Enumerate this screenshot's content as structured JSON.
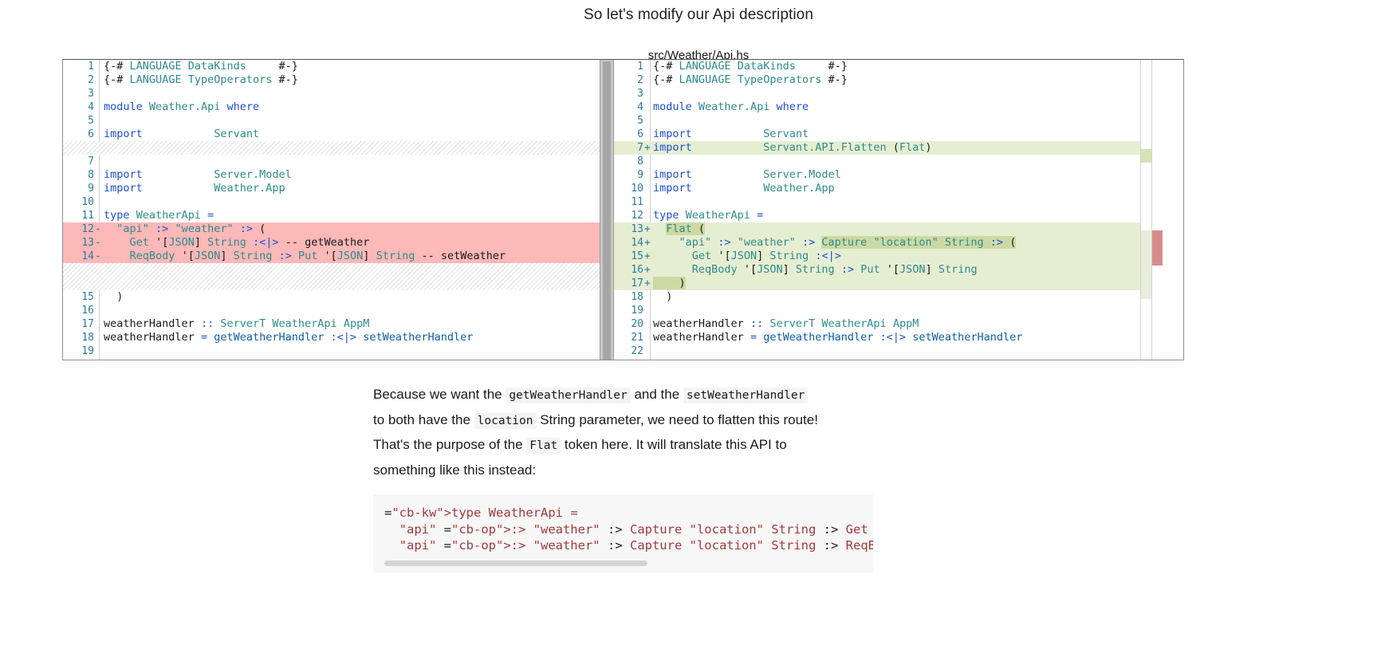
{
  "slide": {
    "title": "So let's modify our Api description",
    "file_caption": "src/Weather/Api.hs"
  },
  "diff": {
    "left": {
      "lines": [
        {
          "num": "1",
          "sign": "",
          "text": "{-# LANGUAGE DataKinds     #-}",
          "state": "context"
        },
        {
          "num": "2",
          "sign": "",
          "text": "{-# LANGUAGE TypeOperators #-}",
          "state": "context"
        },
        {
          "num": "3",
          "sign": "",
          "text": "",
          "state": "context"
        },
        {
          "num": "4",
          "sign": "",
          "text": "module Weather.Api where",
          "state": "context"
        },
        {
          "num": "5",
          "sign": "",
          "text": "",
          "state": "context"
        },
        {
          "num": "6",
          "sign": "",
          "text": "import           Servant",
          "state": "context"
        },
        {
          "num": "",
          "sign": "",
          "text": "",
          "state": "filler"
        },
        {
          "num": "7",
          "sign": "",
          "text": "",
          "state": "context"
        },
        {
          "num": "8",
          "sign": "",
          "text": "import           Server.Model",
          "state": "context"
        },
        {
          "num": "9",
          "sign": "",
          "text": "import           Weather.App",
          "state": "context"
        },
        {
          "num": "10",
          "sign": "",
          "text": "",
          "state": "context"
        },
        {
          "num": "11",
          "sign": "",
          "text": "type WeatherApi =",
          "state": "context"
        },
        {
          "num": "12",
          "sign": "-",
          "text": "  \"api\" :> \"weather\" :> (",
          "state": "deleted"
        },
        {
          "num": "13",
          "sign": "-",
          "text": "    Get '[JSON] String :<|> -- getWeather",
          "state": "deleted"
        },
        {
          "num": "14",
          "sign": "-",
          "text": "    ReqBody '[JSON] String :> Put '[JSON] String -- setWeather",
          "state": "deleted"
        },
        {
          "num": "",
          "sign": "",
          "text": "",
          "state": "filler"
        },
        {
          "num": "",
          "sign": "",
          "text": "",
          "state": "filler"
        },
        {
          "num": "15",
          "sign": "",
          "text": "  )",
          "state": "context"
        },
        {
          "num": "16",
          "sign": "",
          "text": "",
          "state": "context"
        },
        {
          "num": "17",
          "sign": "",
          "text": "weatherHandler :: ServerT WeatherApi AppM",
          "state": "context"
        },
        {
          "num": "18",
          "sign": "",
          "text": "weatherHandler = getWeatherHandler :<|> setWeatherHandler",
          "state": "context"
        },
        {
          "num": "19",
          "sign": "",
          "text": "",
          "state": "context"
        }
      ]
    },
    "right": {
      "lines": [
        {
          "num": "1",
          "sign": "",
          "text": "{-# LANGUAGE DataKinds     #-}",
          "state": "context"
        },
        {
          "num": "2",
          "sign": "",
          "text": "{-# LANGUAGE TypeOperators #-}",
          "state": "context"
        },
        {
          "num": "3",
          "sign": "",
          "text": "",
          "state": "context"
        },
        {
          "num": "4",
          "sign": "",
          "text": "module Weather.Api where",
          "state": "context"
        },
        {
          "num": "5",
          "sign": "",
          "text": "",
          "state": "context"
        },
        {
          "num": "6",
          "sign": "",
          "text": "import           Servant",
          "state": "context"
        },
        {
          "num": "7",
          "sign": "+",
          "text": "import           Servant.API.Flatten (Flat)",
          "state": "added"
        },
        {
          "num": "8",
          "sign": "",
          "text": "",
          "state": "context"
        },
        {
          "num": "9",
          "sign": "",
          "text": "import           Server.Model",
          "state": "context"
        },
        {
          "num": "10",
          "sign": "",
          "text": "import           Weather.App",
          "state": "context"
        },
        {
          "num": "11",
          "sign": "",
          "text": "",
          "state": "context"
        },
        {
          "num": "12",
          "sign": "",
          "text": "type WeatherApi =",
          "state": "context"
        },
        {
          "num": "13",
          "sign": "+",
          "text": "  Flat (",
          "state": "added"
        },
        {
          "num": "14",
          "sign": "+",
          "text": "    \"api\" :> \"weather\" :> Capture \"location\" String :> (",
          "state": "added"
        },
        {
          "num": "15",
          "sign": "+",
          "text": "      Get '[JSON] String :<|>",
          "state": "added"
        },
        {
          "num": "16",
          "sign": "+",
          "text": "      ReqBody '[JSON] String :> Put '[JSON] String",
          "state": "added"
        },
        {
          "num": "17",
          "sign": "+",
          "text": "    )",
          "state": "added"
        },
        {
          "num": "18",
          "sign": "",
          "text": "  )",
          "state": "context"
        },
        {
          "num": "19",
          "sign": "",
          "text": "",
          "state": "context"
        },
        {
          "num": "20",
          "sign": "",
          "text": "weatherHandler :: ServerT WeatherApi AppM",
          "state": "context"
        },
        {
          "num": "21",
          "sign": "",
          "text": "weatherHandler = getWeatherHandler :<|> setWeatherHandler",
          "state": "context"
        },
        {
          "num": "22",
          "sign": "",
          "text": "",
          "state": "context"
        }
      ]
    },
    "colors": {
      "deleted_bg": "#fdb8b8",
      "deleted_word_bg": "#f78e8e",
      "added_bg": "#e6eed2",
      "added_word_bg": "#ccd9a3",
      "gutter_number": "#2b7b9e"
    }
  },
  "prose": {
    "line1_a": "Because we want the ",
    "code1": "getWeatherHandler",
    "line1_b": " and the ",
    "code2": "setWeatherHandler",
    "line2_a": "to both have the ",
    "code3": "location",
    "line2_b": " String parameter, we need to flatten this route!",
    "line3_a": "That's the purpose of the ",
    "code4": "Flat",
    "line3_b": " token here. It will translate this API to",
    "line4": "something like this instead:"
  },
  "codeblock": {
    "line1": "type WeatherApi =",
    "line2": "  \"api\" :> \"weather\" :> Capture \"location\" String :> Get '[JSON",
    "line3": "  \"api\" :> \"weather\" :> Capture \"location\" String :> ReqBody '["
  }
}
